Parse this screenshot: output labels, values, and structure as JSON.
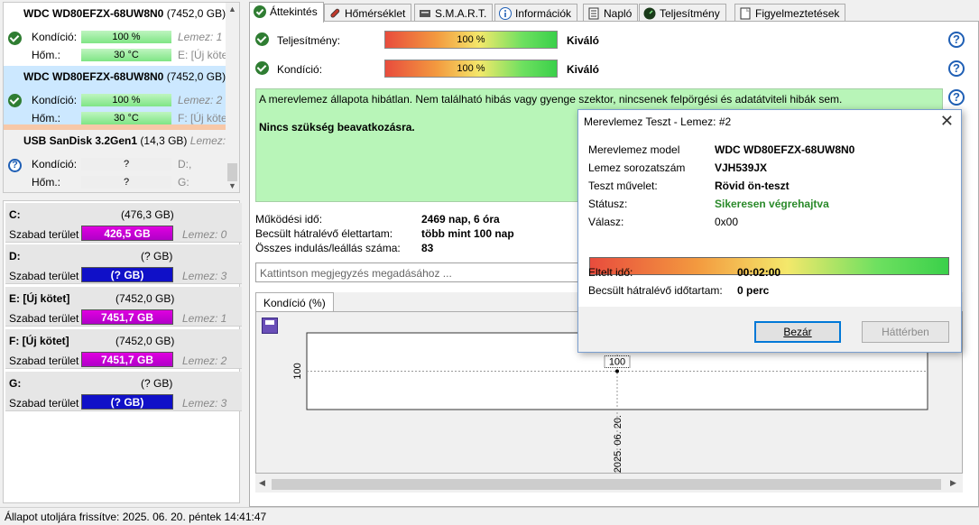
{
  "drives": [
    {
      "model": "WDC WD80EFZX-68UW8N0",
      "size": "(7452,0 GB)",
      "status": "ok",
      "rows": [
        {
          "label": "Kondíció:",
          "value": "100 %",
          "side": "Lemez: 1",
          "bar": "g"
        },
        {
          "label": "Hőm.:",
          "value": "30 °C",
          "side": "E: [Új kötet]",
          "bar": "g"
        }
      ]
    },
    {
      "model": "WDC WD80EFZX-68UW8N0",
      "size": "(7452,0 GB)",
      "status": "ok",
      "rows": [
        {
          "label": "Kondíció:",
          "value": "100 %",
          "side": "Lemez: 2",
          "bar": "g"
        },
        {
          "label": "Hőm.:",
          "value": "30 °C",
          "side": "F: [Új kötet]",
          "bar": "g"
        }
      ]
    },
    {
      "model": "USB SanDisk 3.2Gen1",
      "size": "(14,3 GB)",
      "extra": "Lemez: 3",
      "status": "unknown",
      "rows": [
        {
          "label": "Kondíció:",
          "value": "?",
          "side": "D:,",
          "bar": "gr"
        },
        {
          "label": "Hőm.:",
          "value": "?",
          "side": "G:",
          "bar": "gr"
        }
      ]
    }
  ],
  "volumes": [
    {
      "name": "C:",
      "size": "(476,3 GB)",
      "free_label": "Szabad terület",
      "free": "426,5 GB",
      "disk": "Lemez: 0",
      "color": "m"
    },
    {
      "name": "D:",
      "size": "(? GB)",
      "free_label": "Szabad terület",
      "free": "(? GB)",
      "disk": "Lemez: 3",
      "color": "b"
    },
    {
      "name": "E: [Új kötet]",
      "size": "(7452,0 GB)",
      "free_label": "Szabad terület",
      "free": "7451,7 GB",
      "disk": "Lemez: 1",
      "color": "m"
    },
    {
      "name": "F: [Új kötet]",
      "size": "(7452,0 GB)",
      "free_label": "Szabad terület",
      "free": "7451,7 GB",
      "disk": "Lemez: 2",
      "color": "m"
    },
    {
      "name": "G:",
      "size": "(? GB)",
      "free_label": "Szabad terület",
      "free": "(? GB)",
      "disk": "Lemez: 3",
      "color": "b"
    }
  ],
  "tabs": [
    {
      "label": "Áttekintés",
      "icon": "check-circle-icon"
    },
    {
      "label": "Hőmérséklet",
      "icon": "thermometer-icon"
    },
    {
      "label": "S.M.A.R.T.",
      "icon": "smart-icon"
    },
    {
      "label": "Információk",
      "icon": "info-icon"
    },
    {
      "label": "Napló",
      "icon": "log-icon"
    },
    {
      "label": "Teljesítmény",
      "icon": "speedometer-icon"
    },
    {
      "label": "Figyelmeztetések",
      "icon": "warnings-icon"
    }
  ],
  "overview": {
    "performance_label": "Teljesítmény:",
    "performance_value": "100 %",
    "performance_rating": "Kiváló",
    "health_label": "Kondíció:",
    "health_value": "100 %",
    "health_rating": "Kiváló",
    "status_text": "A merevlemez állapota hibátlan. Nem található hibás vagy gyenge szektor, nincsenek felpörgési és adatátviteli hibák sem.",
    "status_action": "Nincs szükség beavatkozásra.",
    "uptime_label": "Működési idő:",
    "uptime_value": "2469 nap, 6 óra",
    "lifetime_label": "Becsült hátralévő élettartam:",
    "lifetime_value": "több mint 100 nap",
    "startstop_label": "Összes indulás/leállás száma:",
    "startstop_value": "83",
    "note_placeholder": "Kattintson megjegyzés megadásához ..."
  },
  "chart_data": {
    "type": "line",
    "tab_label": "Kondíció  (%)",
    "x": [
      "2025. 06. 20."
    ],
    "series": [
      {
        "values": [
          100
        ]
      }
    ],
    "data_labels": [
      "100"
    ],
    "y_ticks": [
      "100"
    ],
    "ylim": [
      0,
      200
    ],
    "grid": true
  },
  "dialog": {
    "title": "Merevlemez Teszt - Lemez: #2",
    "model_label": "Merevlemez model",
    "model_value": "WDC WD80EFZX-68UW8N0",
    "serial_label": "Lemez sorozatszám",
    "serial_value": "VJH539JX",
    "op_label": "Teszt művelet:",
    "op_value": "Rövid ön-teszt",
    "status_label": "Státusz:",
    "status_value": "Sikeresen végrehajtva",
    "answer_label": "Válasz:",
    "answer_value": "0x00",
    "progress": 100,
    "elapsed_label": "Eltelt idő:",
    "elapsed_value": "00:02:00",
    "remaining_label": "Becsült hátralévő időtartam:",
    "remaining_value": "0 perc",
    "close_button": "Bezár",
    "background_button": "Háttérben",
    "status_color": "#2a8a2a"
  },
  "statusbar": "Állapot utoljára frissítve: 2025. 06. 20. péntek 14:41:47"
}
